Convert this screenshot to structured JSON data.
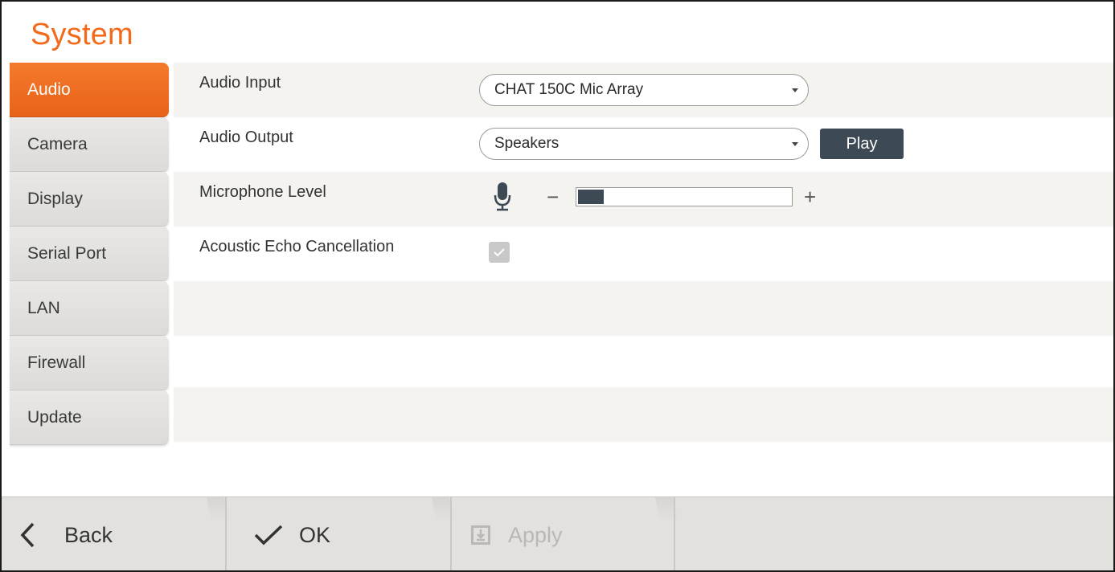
{
  "title": "System",
  "sidebar": {
    "items": [
      {
        "label": "Audio",
        "active": true
      },
      {
        "label": "Camera",
        "active": false
      },
      {
        "label": "Display",
        "active": false
      },
      {
        "label": "Serial Port",
        "active": false
      },
      {
        "label": "LAN",
        "active": false
      },
      {
        "label": "Firewall",
        "active": false
      },
      {
        "label": "Update",
        "active": false
      }
    ]
  },
  "settings": {
    "audio_input": {
      "label": "Audio Input",
      "value": "CHAT 150C Mic Array"
    },
    "audio_output": {
      "label": "Audio Output",
      "value": "Speakers",
      "play_label": "Play"
    },
    "mic_level": {
      "label": "Microphone Level",
      "minus": "−",
      "plus": "+",
      "level_fraction": 0.12
    },
    "aec": {
      "label": "Acoustic Echo Cancellation",
      "checked": true
    }
  },
  "bottom": {
    "back_label": "Back",
    "ok_label": "OK",
    "apply_label": "Apply"
  },
  "icons": {
    "dropdown": "caret-down-icon",
    "mic": "microphone-icon",
    "check": "check-icon",
    "back": "chevron-left-icon",
    "ok": "checkmark-icon",
    "apply": "save-icon"
  },
  "colors": {
    "accent": "#f26a1b",
    "button_dark": "#3d4a55",
    "disabled": "#b9b8b4"
  }
}
